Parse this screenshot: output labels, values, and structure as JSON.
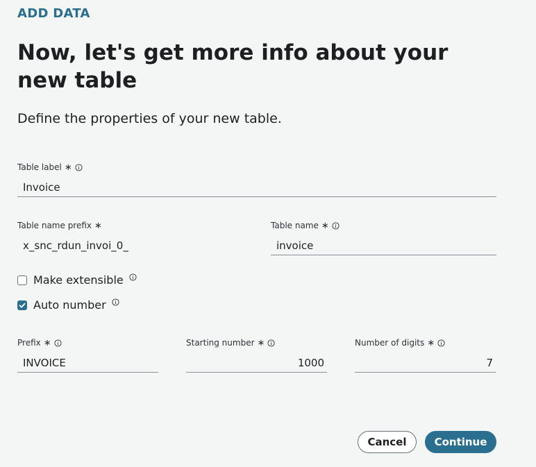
{
  "header": {
    "eyebrow": "ADD DATA",
    "title": "Now, let's get more info about your new table",
    "subtitle": "Define the properties of your new table."
  },
  "fields": {
    "table_label": {
      "label": "Table label",
      "value": "Invoice"
    },
    "table_name_prefix": {
      "label": "Table name prefix",
      "value": "x_snc_rdun_invoi_0_"
    },
    "table_name": {
      "label": "Table name",
      "value": "invoice"
    },
    "prefix": {
      "label": "Prefix",
      "value": "INVOICE"
    },
    "starting_number": {
      "label": "Starting number",
      "value": "1000"
    },
    "number_of_digits": {
      "label": "Number of digits",
      "value": "7"
    }
  },
  "options": {
    "make_extensible": {
      "label": "Make extensible",
      "checked": false
    },
    "auto_number": {
      "label": "Auto number",
      "checked": true
    }
  },
  "actions": {
    "cancel_label": "Cancel",
    "continue_label": "Continue"
  },
  "colors": {
    "accent": "#2a6f8f",
    "background": "#f4f5f5"
  },
  "icons": {
    "required": "asterisk-icon",
    "info": "info-icon",
    "check": "checkmark-icon"
  }
}
